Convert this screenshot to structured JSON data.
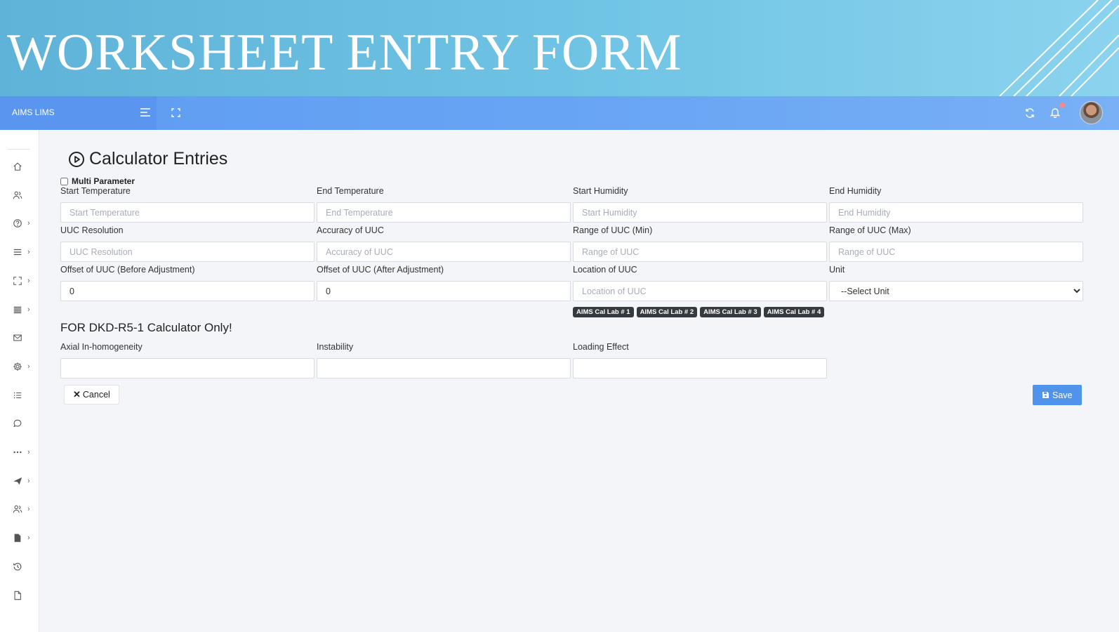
{
  "banner": {
    "title": "WORKSHEET ENTRY FORM"
  },
  "navbar": {
    "brand": "AIMS LIMS",
    "icons": [
      "menu-icon",
      "fullscreen-icon",
      "refresh-icon",
      "bell-icon",
      "avatar"
    ]
  },
  "sidebar": {
    "items": [
      {
        "icon": "home-icon",
        "has_submenu": false
      },
      {
        "icon": "users-icon",
        "has_submenu": false
      },
      {
        "icon": "help-icon",
        "has_submenu": true
      },
      {
        "icon": "list-icon",
        "has_submenu": true
      },
      {
        "icon": "expand-icon",
        "has_submenu": true
      },
      {
        "icon": "stack-icon",
        "has_submenu": true
      },
      {
        "icon": "mail-icon",
        "has_submenu": false
      },
      {
        "icon": "gear-icon",
        "has_submenu": true
      },
      {
        "icon": "bullet-list-icon",
        "has_submenu": false
      },
      {
        "icon": "chat-icon",
        "has_submenu": false
      },
      {
        "icon": "more-icon",
        "has_submenu": true
      },
      {
        "icon": "send-icon",
        "has_submenu": true
      },
      {
        "icon": "group-icon",
        "has_submenu": true
      },
      {
        "icon": "document-icon",
        "has_submenu": true
      },
      {
        "icon": "history-icon",
        "has_submenu": false
      },
      {
        "icon": "file-icon",
        "has_submenu": false
      }
    ],
    "chevron": "›"
  },
  "page": {
    "title": "Calculator Entries",
    "multi_parameter_label": "Multi Parameter"
  },
  "form": {
    "fields": [
      {
        "label": "Start Temperature",
        "placeholder": "Start Temperature",
        "value": ""
      },
      {
        "label": "End Temperature",
        "placeholder": "End Temperature",
        "value": ""
      },
      {
        "label": "Start Humidity",
        "placeholder": "Start Humidity",
        "value": ""
      },
      {
        "label": "End Humidity",
        "placeholder": "End Humidity",
        "value": ""
      },
      {
        "label": "UUC Resolution",
        "placeholder": "UUC Resolution",
        "value": ""
      },
      {
        "label": "Accuracy of UUC",
        "placeholder": "Accuracy of UUC",
        "value": ""
      },
      {
        "label": "Range of UUC (Min)",
        "placeholder": "Range of UUC",
        "value": ""
      },
      {
        "label": "Range of UUC (Max)",
        "placeholder": "Range of UUC",
        "value": ""
      },
      {
        "label": "Offset of UUC (Before Adjustment)",
        "placeholder": "",
        "value": "0"
      },
      {
        "label": "Offset of UUC (After Adjustment)",
        "placeholder": "",
        "value": "0"
      },
      {
        "label": "Location of UUC",
        "placeholder": "Location of UUC",
        "value": ""
      }
    ],
    "unit": {
      "label": "Unit",
      "selected": "--Select Unit"
    },
    "location_badges": [
      "AIMS Cal Lab # 1",
      "AIMS Cal Lab # 2",
      "AIMS Cal Lab # 3",
      "AIMS Cal Lab # 4"
    ],
    "dkd_section_title": "FOR DKD-R5-1 Calculator Only!",
    "dkd_fields": [
      {
        "label": "Axial In-homogeneity",
        "value": ""
      },
      {
        "label": "Instability",
        "value": ""
      },
      {
        "label": "Loading Effect",
        "value": ""
      }
    ]
  },
  "actions": {
    "cancel_label": "Cancel",
    "save_label": "Save"
  },
  "colors": {
    "navbar": "#6aa6f4",
    "save_button": "#4f94ea",
    "badge": "#343a40"
  }
}
